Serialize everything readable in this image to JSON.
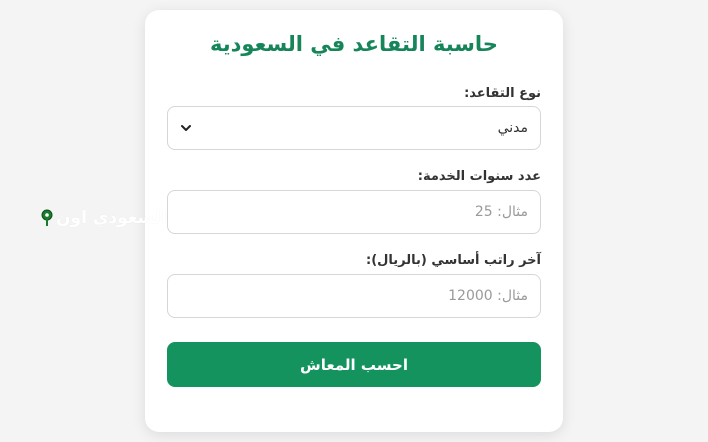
{
  "calculator": {
    "title": "حاسبة التقاعد في السعودية",
    "retirement_type_label": "نوع التقاعد:",
    "retirement_type_value": "مدني",
    "service_years_label": "عدد سنوات الخدمة:",
    "service_years_placeholder": "مثال: 25",
    "salary_label": "آخر راتب أساسي (بالريال):",
    "salary_placeholder": "مثال: 12000",
    "submit_label": "احسب المعاش"
  },
  "watermark": {
    "text": "السعودي اون",
    "pin_icon": "map-pin-icon"
  },
  "colors": {
    "accent": "#15935f",
    "title": "#16855a",
    "pin": "#1a7a2e"
  }
}
